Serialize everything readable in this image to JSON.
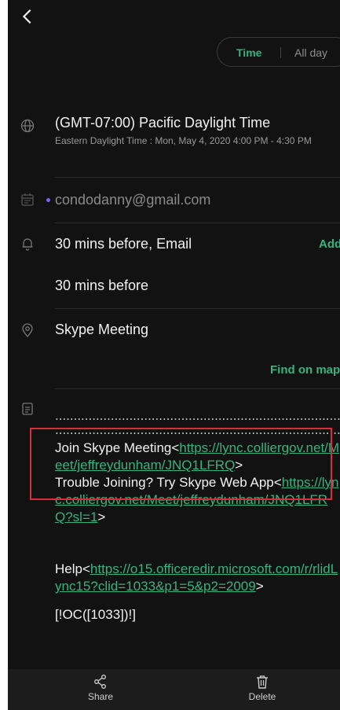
{
  "header": {
    "back_icon": "chevron-left-icon",
    "toggle": {
      "time_label": "Time",
      "allday_label": "All day"
    }
  },
  "timezone": {
    "primary": "(GMT-07:00) Pacific Daylight Time",
    "secondary": "Eastern Daylight Time : Mon, May 4, 2020 4:00 PM - 4:30 PM"
  },
  "calendar": {
    "account": "condodanny@gmail.com",
    "dot_color": "#7b61ff"
  },
  "reminder": {
    "first": "30 mins before, Email",
    "add_label": "Add",
    "second": "30 mins before"
  },
  "location": {
    "value": "Skype Meeting",
    "find_on_map": "Find on map"
  },
  "notes": {
    "dots_line1": "..............................................................................................",
    "dots_line2": "..............................................................................................",
    "join_text": "Join Skype Meeting<",
    "join_link": "https://lync.colliergov.net/Meet/jeffreydunham/JNQ1LFRQ",
    "join_suffix": ">",
    "trouble_text": "Trouble Joining? Try Skype Web App<",
    "trouble_link": "https://lync.colliergov.net/Meet/jeffreydunham/JNQ1LFRQ?sl=1",
    "trouble_suffix": ">",
    "help_text": "Help<",
    "help_link": "https://o15.officeredir.microsoft.com/r/rlidLync15?clid=1033&p1=5&p2=2009",
    "help_suffix": ">",
    "footer": "[!OC([1033])!]"
  },
  "bottom_bar": {
    "share_label": "Share",
    "delete_label": "Delete"
  },
  "colors": {
    "accent": "#36b37e",
    "background": "#121212",
    "highlight_border": "#d62f3c"
  }
}
